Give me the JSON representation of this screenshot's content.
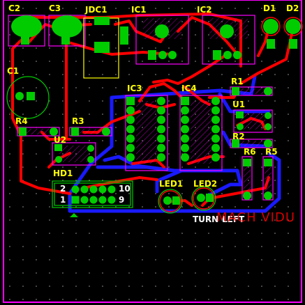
{
  "colors": {
    "background": "#000000",
    "board_outline": "#ff00ff",
    "grid_dot": "#9a9a9a",
    "top_trace": "#ff0000",
    "bottom_trace": "#1a1aff",
    "pad": "#00cc00",
    "silkscreen": "#ffff00",
    "text_red": "#ff0000",
    "text_white": "#ffffff"
  },
  "labels": {
    "c2": "C2",
    "c3": "C3",
    "jdc1": "JDC1",
    "ic1": "IC1",
    "ic2": "IC2",
    "d1": "D1",
    "d2": "D2",
    "c1": "C1",
    "ic3": "IC3",
    "ic4": "IC4",
    "r1": "R1",
    "u1": "U1",
    "r4": "R4",
    "r3": "R3",
    "u2": "U2",
    "r2": "R2",
    "r6": "R6",
    "r5": "R5",
    "hd1": "HD1",
    "led1": "LED1",
    "led2": "LED2",
    "hd_pin2": "2",
    "hd_pin1": "1",
    "hd_pin10": "10",
    "hd_pin9": "9",
    "turn": "TURN",
    "left": "LEFT",
    "board_text": "MACH VIDU"
  }
}
